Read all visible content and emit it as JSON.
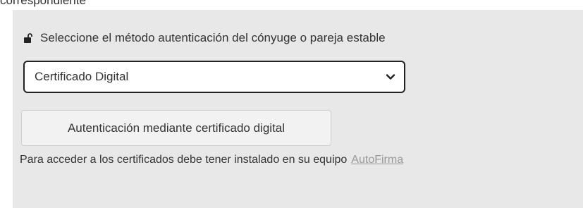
{
  "header": {
    "partial_text": "correspondiente"
  },
  "auth_section": {
    "title": "Seleccione el método autenticación del cónyuge o pareja estable",
    "lock_icon": "lock-open-icon",
    "method_select": {
      "selected_value": "Certificado Digital",
      "icon": "chevron-down-icon"
    },
    "auth_button_label": "Autenticación mediante certificado digital",
    "info_text": "Para acceder a los certificados debe tener instalado en su equipo",
    "info_link": "AutoFirma"
  },
  "colors": {
    "panel_background": "#e8e8e8",
    "text": "#333333",
    "link": "#999999",
    "select_border": "#222222"
  }
}
